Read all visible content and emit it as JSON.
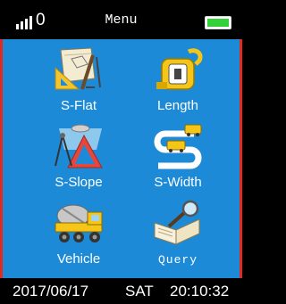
{
  "status_bar": {
    "signal_count": "0",
    "title": "Menu",
    "battery_icon": "battery-full-icon",
    "battery_color": "#34d13a"
  },
  "menu": {
    "items": [
      {
        "label": "S-Flat",
        "icon": "drafting-tools-icon"
      },
      {
        "label": "Length",
        "icon": "tape-measure-icon"
      },
      {
        "label": "S-Slope",
        "icon": "slope-triangle-icon"
      },
      {
        "label": "S-Width",
        "icon": "road-width-icon"
      },
      {
        "label": "Vehicle",
        "icon": "cement-truck-icon"
      },
      {
        "label": "Query",
        "icon": "book-search-icon"
      }
    ]
  },
  "footer": {
    "date": "2017/06/17",
    "weekday": "SAT",
    "time": "20:10:32"
  },
  "colors": {
    "panel_background": "#1d8ad8",
    "panel_border": "#e02c1f"
  }
}
